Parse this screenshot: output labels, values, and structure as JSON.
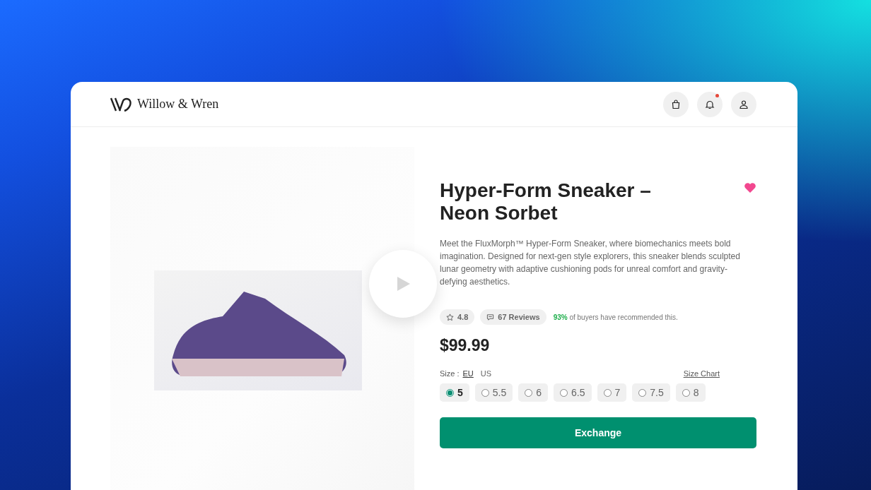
{
  "brand": {
    "name": "Willow & Wren"
  },
  "header": {
    "notification_badge": true
  },
  "product": {
    "title": "Hyper-Form Sneaker – Neon Sorbet",
    "favorite": true,
    "description": "Meet the FluxMorph™ Hyper-Form Sneaker, where biomechanics meets bold imagination. Designed for next-gen style explorers, this sneaker blends sculpted lunar geometry with adaptive cushioning pods for unreal comfort and gravity-defying aesthetics.",
    "rating": "4.8",
    "reviews": "67 Reviews",
    "recommend_percent": "93%",
    "recommend_text": "of buyers have recommended this.",
    "price": "$99.99"
  },
  "size": {
    "label": "Size :",
    "systems": [
      {
        "label": "EU",
        "selected": true
      },
      {
        "label": "US",
        "selected": false
      }
    ],
    "chart_link": "Size Chart",
    "options": [
      {
        "label": "5",
        "selected": true
      },
      {
        "label": "5.5",
        "selected": false
      },
      {
        "label": "6",
        "selected": false
      },
      {
        "label": "6.5",
        "selected": false
      },
      {
        "label": "7",
        "selected": false
      },
      {
        "label": "7.5",
        "selected": false
      },
      {
        "label": "8",
        "selected": false
      }
    ]
  },
  "action": {
    "label": "Exchange"
  }
}
